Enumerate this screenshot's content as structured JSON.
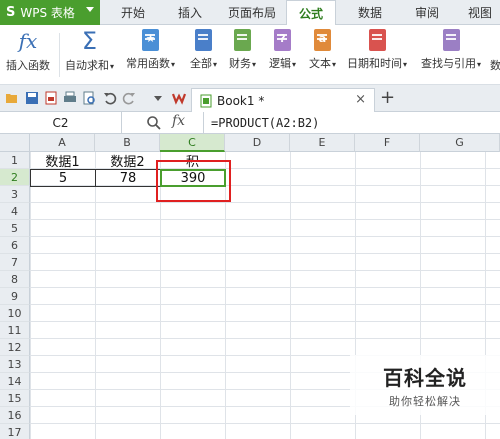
{
  "app": {
    "name": "WPS 表格",
    "logo": "S",
    "accent_color": "#4a9e2e"
  },
  "menu": {
    "tabs": [
      {
        "label": "开始"
      },
      {
        "label": "插入"
      },
      {
        "label": "页面布局"
      },
      {
        "label": "公式"
      },
      {
        "label": "数据"
      },
      {
        "label": "审阅"
      },
      {
        "label": "视图"
      }
    ],
    "active_tab": "公式"
  },
  "ribbon": {
    "insert_function": {
      "label": "插入函数",
      "icon": "fx-icon"
    },
    "autosum": {
      "label": "自动求和",
      "icon": "sigma-icon"
    },
    "common_functions": {
      "label": "常用函数",
      "icon": "star-book-icon",
      "color": "#4a8fd6"
    },
    "all": {
      "label": "全部",
      "icon": "book-icon",
      "color": "#4a7fc9"
    },
    "financial": {
      "label": "财务",
      "icon": "book-icon",
      "color": "#6aa84f"
    },
    "logical": {
      "label": "逻辑",
      "icon": "question-book-icon",
      "color": "#a57cc8",
      "glyph": "?"
    },
    "text": {
      "label": "文本",
      "icon": "text-book-icon",
      "color": "#e08a3a",
      "glyph": "a"
    },
    "datetime": {
      "label": "日期和时间",
      "icon": "clock-book-icon",
      "color": "#d9534f"
    },
    "lookup": {
      "label": "查找与引用",
      "icon": "search-book-icon",
      "color": "#9b7fc4"
    },
    "overflow": {
      "label": "数"
    }
  },
  "document": {
    "tab_name": "Book1 *",
    "close_glyph": "×",
    "new_tab_glyph": "+"
  },
  "formula_bar": {
    "name_box": "C2",
    "fx": "fx",
    "formula": "=PRODUCT(A2:B2)"
  },
  "columns": [
    "A",
    "B",
    "C",
    "D",
    "E",
    "F",
    "G"
  ],
  "rows": [
    "1",
    "2",
    "3",
    "4",
    "5",
    "6",
    "7",
    "8",
    "9",
    "10",
    "11",
    "12",
    "13",
    "14",
    "15",
    "16",
    "17"
  ],
  "cells": {
    "A1": "数据1",
    "B1": "数据2",
    "C1": "积",
    "A2": "5",
    "B2": "78",
    "C2": "390"
  },
  "watermark": {
    "title": "百科全说",
    "subtitle": "助你轻松解决"
  }
}
